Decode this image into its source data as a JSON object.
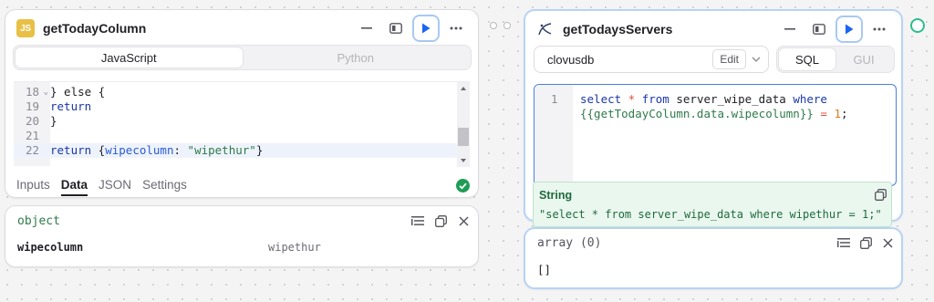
{
  "left_query": {
    "badge": "JS",
    "title": "getTodayColumn",
    "lang_tabs": [
      "JavaScript",
      "Python"
    ],
    "code_lines": [
      {
        "n": "18",
        "fold": "⌄"
      },
      {
        "n": "19"
      },
      {
        "n": "20"
      },
      {
        "n": "21"
      },
      {
        "n": "22"
      }
    ],
    "code_text": {
      "l18": "} else {",
      "l19": "return",
      "l20": "}",
      "l22_kw": "return",
      "l22_open": " {",
      "l22_key": "wipecolumn",
      "l22_colon": ": ",
      "l22_str": "\"wipethur\"",
      "l22_close": "}"
    },
    "bottom_tabs": [
      "Inputs",
      "Data",
      "JSON",
      "Settings"
    ],
    "status": "success"
  },
  "left_result": {
    "type_label": "object",
    "key": "wipecolumn",
    "value": "wipethur"
  },
  "right_query": {
    "title": "getTodaysServers",
    "datasource": "clovusdb",
    "edit_label": "Edit",
    "mode_tabs": [
      "SQL",
      "GUI"
    ],
    "line_no": "1",
    "sql": {
      "kw_select": "select",
      "star": " * ",
      "kw_from": "from",
      "table": " server_wipe_data ",
      "kw_where": "where",
      "template": "{{getTodayColumn.data.wipecolumn}}",
      "eq": " = ",
      "num": "1",
      "semi": ";"
    },
    "tooltip_type": "String",
    "tooltip_value": "\"select * from server_wipe_data where wipethur = 1;\""
  },
  "right_result": {
    "type_label": "array (0)",
    "value": "[]"
  },
  "colors": {
    "accent": "#1c64f2",
    "success": "#1f9d55",
    "string_green": "#2f7a4a",
    "keyword_blue": "#1b37a6"
  }
}
